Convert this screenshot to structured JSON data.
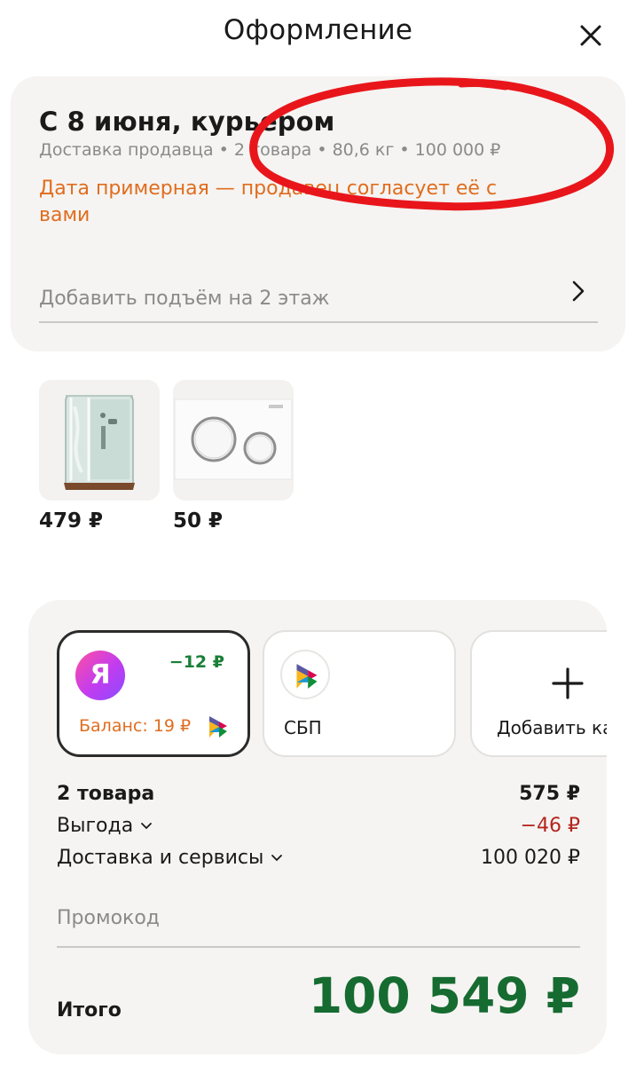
{
  "header": {
    "title": "Оформление"
  },
  "delivery": {
    "title": "С 8 июня, курьером",
    "meta": "Доставка продавца • 2 товара • 80,6 кг • 100 000 ₽",
    "note": "Дата примерная — продавец согласует её с вами",
    "lift_label": "Добавить подъём на 2 этаж"
  },
  "products": [
    {
      "price": "479 ₽",
      "icon": "shower-cabin"
    },
    {
      "price": "50 ₽",
      "icon": "flush-plate"
    }
  ],
  "payment": {
    "options": [
      {
        "logo": "Я",
        "cashback": "−12 ₽",
        "balance": "Баланс: 19 ₽"
      },
      {
        "label": "СБП"
      },
      {
        "label": "Добавить карту"
      }
    ]
  },
  "summary": {
    "items_label": "2 товара",
    "items_value": "575 ₽",
    "benefit_label": "Выгода",
    "benefit_value": "−46 ₽",
    "delivery_label": "Доставка и сервисы",
    "delivery_value": "100 020 ₽",
    "promo_placeholder": "Промокод",
    "total_label": "Итого",
    "total_value": "100 549 ₽"
  },
  "colors": {
    "accent_orange": "#e06d1f",
    "total_green": "#166b31",
    "discount_red": "#b3261e",
    "annotation_red": "#e8161b"
  }
}
